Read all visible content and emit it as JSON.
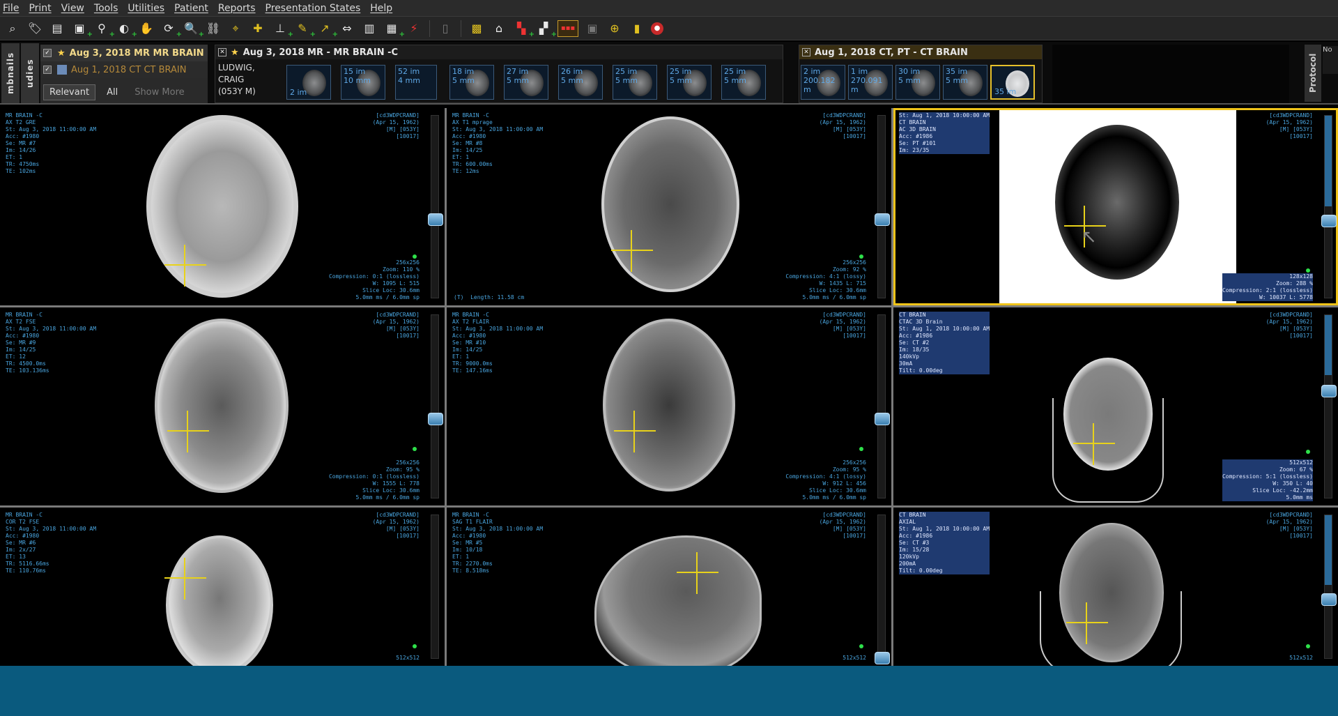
{
  "menu": [
    "File",
    "Print",
    "View",
    "Tools",
    "Utilities",
    "Patient",
    "Reports",
    "Presentation States",
    "Help"
  ],
  "toolbar": {
    "icons": [
      "zoom-window-icon",
      "tag-icon",
      "document-icon",
      "layout-icon",
      "magnify-icon",
      "window-level-icon",
      "pan-hand-icon",
      "rotate-icon",
      "zoom-icon",
      "link-icon",
      "crosshair-icon",
      "measure-icon",
      "ruler-icon",
      "arrow-icon",
      "cine-icon",
      "mpr-icon",
      "volume-icon",
      "color-icon",
      "palette-icon",
      "report-icon",
      "key-image-icon",
      "hanging-protocol-icon",
      "sync-icon",
      "display-icon",
      "screen-icon",
      "stop-icon"
    ]
  },
  "sidebar_tabs": {
    "left": "mbnails",
    "left2": "udies",
    "right": "Protocol",
    "right_note": "No"
  },
  "study_list": {
    "rows": [
      {
        "date": "Aug 3, 2018",
        "modality": "MR",
        "desc": "MR BRAIN"
      },
      {
        "date": "Aug 1, 2018",
        "modality": "CT",
        "desc": "CT BRAIN"
      }
    ],
    "filters": [
      "Relevant",
      "All",
      "Show More"
    ]
  },
  "group1": {
    "title": "Aug 3, 2018   MR - MR BRAIN -C",
    "patient": [
      "LUDWIG,",
      "CRAIG",
      "(053Y M)"
    ],
    "thumbs": [
      {
        "l1": "",
        "l2": "2 im"
      },
      {
        "l1": "15 im",
        "l2": "10 mm"
      },
      {
        "l1": "52 im",
        "l2": "4 mm"
      },
      {
        "l1": "18 im",
        "l2": "5 mm"
      },
      {
        "l1": "27 im",
        "l2": "5 mm"
      },
      {
        "l1": "26 im",
        "l2": "5 mm"
      },
      {
        "l1": "25 im",
        "l2": "5 mm"
      },
      {
        "l1": "25 im",
        "l2": "5 mm"
      },
      {
        "l1": "25 im",
        "l2": "5 mm"
      }
    ]
  },
  "group2": {
    "title": "Aug 1, 2018   CT, PT - CT BRAIN",
    "thumbs": [
      {
        "l1": "2 im",
        "l2": "200.182 m"
      },
      {
        "l1": "1 im",
        "l2": "270.091 m"
      },
      {
        "l1": "30 im",
        "l2": "5 mm"
      },
      {
        "l1": "35 im",
        "l2": "5 mm"
      },
      {
        "l1": "35 im",
        "l2": ""
      }
    ]
  },
  "viewports": [
    {
      "tl": "MR BRAIN -C\nAX T2 GRE\nSt: Aug 3, 2018 11:00:00 AM\nAcc: #1980\nSe: MR #7\nIm: 14/26\nET: 1\nTR: 4750ms\nTE: 102ms",
      "tr": "[cd3WDPCRAND]\n(Apr 15, 1962)\n[M] [053Y]\n[10017]",
      "br": "256x256\nZoom: 110 %\nCompression: 0:1 (lossless)\nW: 1095 L: 515\nSlice Loc: 30.6mm\n5.0mm ms / 6.0mm sp",
      "bl": ""
    },
    {
      "tl": "MR BRAIN -C\nAX T1 mprage\nSt: Aug 3, 2018 11:00:00 AM\nAcc: #1980\nSe: MR #8\nIm: 14/25\nET: 1\nTR: 600.00ms\nTE: 12ms",
      "tr": "[cd3WDPCRAND]\n(Apr 15, 1962)\n[M] [053Y]\n[10017]",
      "br": "256x256\nZoom: 92 %\nCompression: 4:1 (lossy)\nW: 1435 L: 715\nSlice Loc: 30.6mm\n5.0mm ms / 6.0mm sp",
      "bl": "(T)  Length: 11.58 cm"
    },
    {
      "tl": "St: Aug 1, 2018 10:00:00 AM\nCT BRAIN\nAC 3D BRAIN\nAcc: #1986\nSe: PT #101\nIm: 23/35",
      "tr": "[cd3WDPCRAND]\n(Apr 15, 1962)\n[M] [053Y]\n[10017]",
      "br": "128x128\nZoom: 288 %\nCompression: 2:1 (lossless)\nW: 10037 L: 5778",
      "bl": ""
    },
    {
      "tl": "MR BRAIN -C\nAX T2 FSE\nSt: Aug 3, 2018 11:00:00 AM\nAcc: #1980\nSe: MR #9\nIm: 14/25\nET: 12\nTR: 4500.0ms\nTE: 103.136ms",
      "tr": "[cd3WDPCRAND]\n(Apr 15, 1962)\n[M] [053Y]\n[10017]",
      "br": "256x256\nZoom: 95 %\nCompression: 0:1 (lossless)\nW: 1555 L: 778\nSlice Loc: 30.6mm\n5.0mm ms / 6.0mm sp",
      "bl": ""
    },
    {
      "tl": "MR BRAIN -C\nAX T2 FLAIR\nSt: Aug 3, 2018 11:00:00 AM\nAcc: #1980\nSe: MR #10\nIm: 14/25\nET: 1\nTR: 9000.0ms\nTE: 147.16ms",
      "tr": "[cd3WDPCRAND]\n(Apr 15, 1962)\n[M] [053Y]\n[10017]",
      "br": "256x256\nZoom: 95 %\nCompression: 4:1 (lossy)\nW: 912 L: 456\nSlice Loc: 30.6mm\n5.0mm ms / 6.0mm sp",
      "bl": ""
    },
    {
      "tl": "CT BRAIN\nCTAC 3D Brain\nSt: Aug 1, 2018 10:00:00 AM\nAcc: #1986\nSe: CT #2\nIm: 18/35\n140kVp\n30mA\nTilt: 0.00deg",
      "tr": "[cd3WDPCRAND]\n(Apr 15, 1962)\n[M] [053Y]\n[10017]",
      "br": "512x512\nZoom: 67 %\nCompression: 5:1 (lossless)\nW: 350 L: 40\nSlice Loc: -42.2mm\n5.0mm ms",
      "bl": ""
    },
    {
      "tl": "MR BRAIN -C\nCOR T2 FSE\nSt: Aug 3, 2018 11:00:00 AM\nAcc: #1980\nSe: MR #6\nIm: 2x/27\nET: 13\nTR: 5116.66ms\nTE: 110.76ms",
      "tr": "[cd3WDPCRAND]\n(Apr 15, 1962)\n[M] [053Y]\n[10017]",
      "br": "512x512",
      "bl": ""
    },
    {
      "tl": "MR BRAIN -C\nSAG T1 FLAIR\nSt: Aug 3, 2018 11:00:00 AM\nAcc: #1980\nSe: MR #5\nIm: 10/18\nET: 1\nTR: 2270.0ms\nTE: 8.518ms",
      "tr": "[cd3WDPCRAND]\n(Apr 15, 1962)\n[M] [053Y]\n[10017]",
      "br": "512x512",
      "bl": ""
    },
    {
      "tl": "CT BRAIN\nAXIAL\nSt: Aug 1, 2018 10:00:00 AM\nAcc: #1986\nSe: CT #3\nIm: 15/28\n120kVp\n200mA\nTilt: 0.00deg",
      "tr": "[cd3WDPCRAND]\n(Apr 15, 1962)\n[M] [053Y]\n[10017]",
      "br": "512x512",
      "bl": ""
    }
  ]
}
